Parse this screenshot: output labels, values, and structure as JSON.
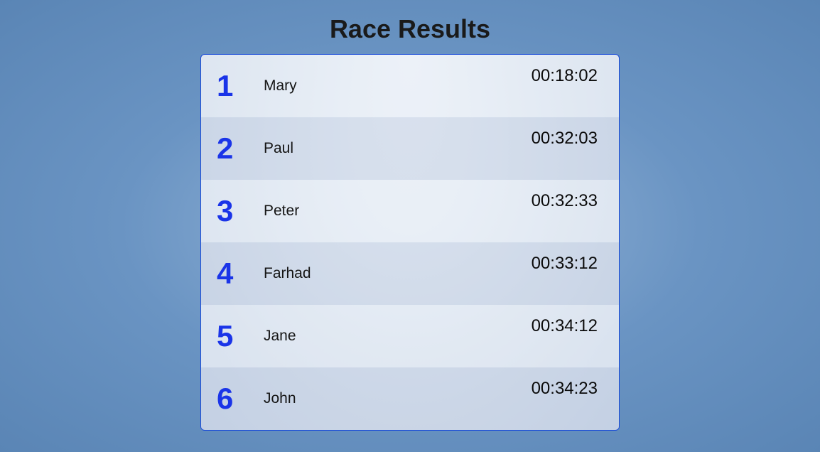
{
  "title": "Race Results",
  "results": [
    {
      "rank": "1",
      "name": "Mary",
      "time": "00:18:02"
    },
    {
      "rank": "2",
      "name": "Paul",
      "time": "00:32:03"
    },
    {
      "rank": "3",
      "name": "Peter",
      "time": "00:32:33"
    },
    {
      "rank": "4",
      "name": "Farhad",
      "time": "00:33:12"
    },
    {
      "rank": "5",
      "name": "Jane",
      "time": "00:34:12"
    },
    {
      "rank": "6",
      "name": "John",
      "time": "00:34:23"
    }
  ]
}
